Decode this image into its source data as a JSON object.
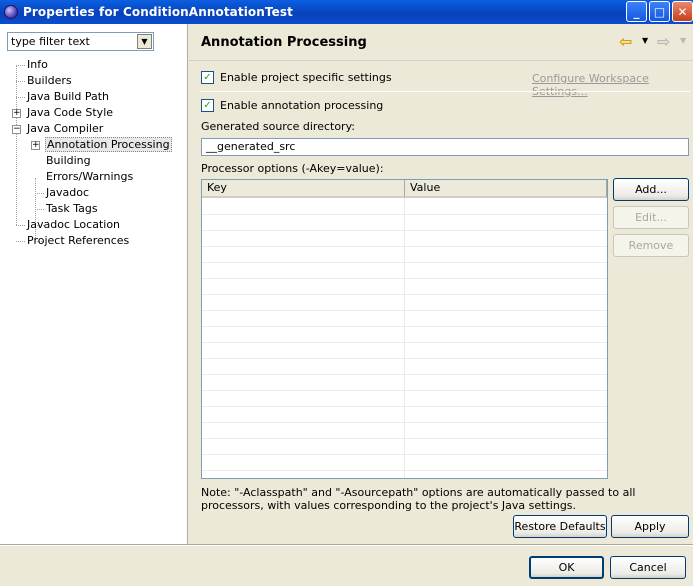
{
  "window": {
    "title": "Properties for ConditionAnnotationTest",
    "minimize": "_",
    "maximize": "□",
    "close": "✕"
  },
  "filter": {
    "placeholder": "type filter text",
    "arrow": "▼"
  },
  "tree": {
    "collapse_glyph": "−",
    "expand_glyph": "+",
    "items": [
      {
        "label": "Info"
      },
      {
        "label": "Builders"
      },
      {
        "label": "Java Build Path"
      },
      {
        "label": "Java Code Style"
      },
      {
        "label": "Java Compiler"
      },
      {
        "label": "Annotation Processing"
      },
      {
        "label": "Building"
      },
      {
        "label": "Errors/Warnings"
      },
      {
        "label": "Javadoc"
      },
      {
        "label": "Task Tags"
      },
      {
        "label": "Javadoc Location"
      },
      {
        "label": "Project References"
      }
    ]
  },
  "page": {
    "title": "Annotation Processing",
    "nav_back": "⇦",
    "nav_forward": "⇨",
    "nav_dropdown": "▼",
    "enable_project_specific": {
      "label": "Enable project specific settings",
      "checked": true
    },
    "configure_workspace_link": "Configure Workspace Settings...",
    "enable_annotation_processing": {
      "label": "Enable annotation processing",
      "checked": true
    },
    "check_glyph": "✓",
    "generated_source_label": "Generated source directory:",
    "generated_source_value": "__generated_src",
    "processor_options_label": "Processor options (-Akey=value):",
    "table": {
      "columns": [
        "Key",
        "Value"
      ],
      "rows": []
    },
    "buttons": {
      "add": "Add...",
      "edit": "Edit...",
      "remove": "Remove",
      "restore_defaults": "Restore Defaults",
      "apply": "Apply"
    },
    "note": "Note: \"-Aclasspath\" and \"-Asourcepath\" options are automatically passed to all processors, with values corresponding to the project's Java settings."
  },
  "dialog_buttons": {
    "ok": "OK",
    "cancel": "Cancel"
  }
}
